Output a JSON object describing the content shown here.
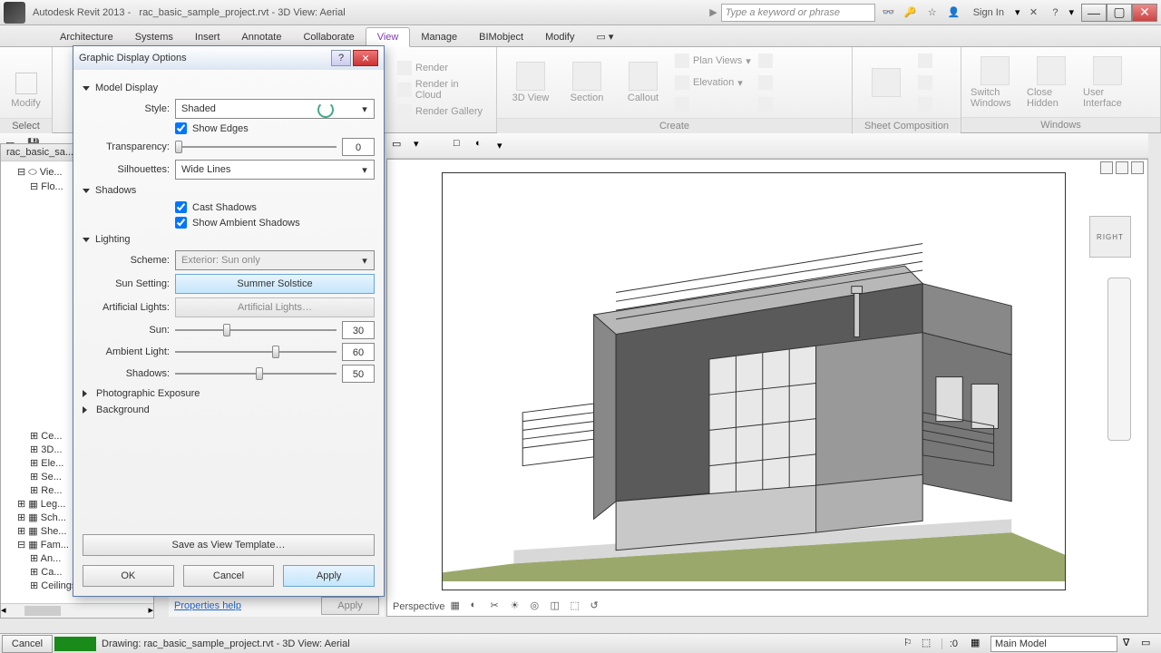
{
  "titlebar": {
    "app": "Autodesk Revit 2013 -",
    "file": "rac_basic_sample_project.rvt - 3D View: Aerial",
    "search_placeholder": "Type a keyword or phrase",
    "signin": "Sign In"
  },
  "ribbon": {
    "tabs": [
      "Architecture",
      "Systems",
      "Insert",
      "Annotate",
      "Collaborate",
      "View",
      "Manage",
      "BIMobject",
      "Modify"
    ],
    "active": "View",
    "select_panel": {
      "modify": "Modify",
      "title": "Select"
    },
    "render_items": [
      "Render",
      "Render in Cloud",
      "Render Gallery"
    ],
    "view3d": "3D View",
    "section": "Section",
    "callout": "Callout",
    "plan_views": "Plan Views",
    "elevation": "Elevation",
    "create_title": "Create",
    "sheet_comp_title": "Sheet Composition",
    "switch_windows": "Switch Windows",
    "close_hidden": "Close Hidden",
    "user_interface": "User Interface",
    "windows_title": "Windows"
  },
  "browser": {
    "title": "rac_basic_sa...",
    "nodes": [
      "Vie...",
      "Flo...",
      "Ce...",
      "3D...",
      "Ele...",
      "Se...",
      "Re...",
      "Leg...",
      "Sch...",
      "She...",
      "Fam...",
      "An...",
      "Ca...",
      "Ceilings"
    ]
  },
  "dialog": {
    "title": "Graphic Display Options",
    "sections": {
      "model_display": "Model Display",
      "shadows": "Shadows",
      "lighting": "Lighting",
      "photo": "Photographic Exposure",
      "background": "Background"
    },
    "labels": {
      "style": "Style:",
      "transparency": "Transparency:",
      "silhouettes": "Silhouettes:",
      "scheme": "Scheme:",
      "sun_setting": "Sun Setting:",
      "artificial": "Artificial Lights:",
      "sun": "Sun:",
      "ambient": "Ambient Light:",
      "shadows_lbl": "Shadows:"
    },
    "values": {
      "style": "Shaded",
      "show_edges": "Show Edges",
      "transparency": "0",
      "silhouettes": "Wide Lines",
      "cast_shadows": "Cast Shadows",
      "ambient_shadows": "Show Ambient Shadows",
      "scheme": "Exterior: Sun only",
      "sun_setting": "Summer Solstice",
      "artificial": "Artificial Lights…",
      "sun": "30",
      "ambient": "60",
      "shadows": "50"
    },
    "buttons": {
      "save_template": "Save as View Template…",
      "ok": "OK",
      "cancel": "Cancel",
      "apply": "Apply"
    }
  },
  "properties": {
    "help": "Properties help",
    "apply": "Apply"
  },
  "viewport": {
    "label": "Perspective",
    "viewcube": "RIGHT"
  },
  "status": {
    "cancel": "Cancel",
    "message": "Drawing: rac_basic_sample_project.rvt - 3D View: Aerial",
    "coord": ":0",
    "workset": "Main Model"
  }
}
